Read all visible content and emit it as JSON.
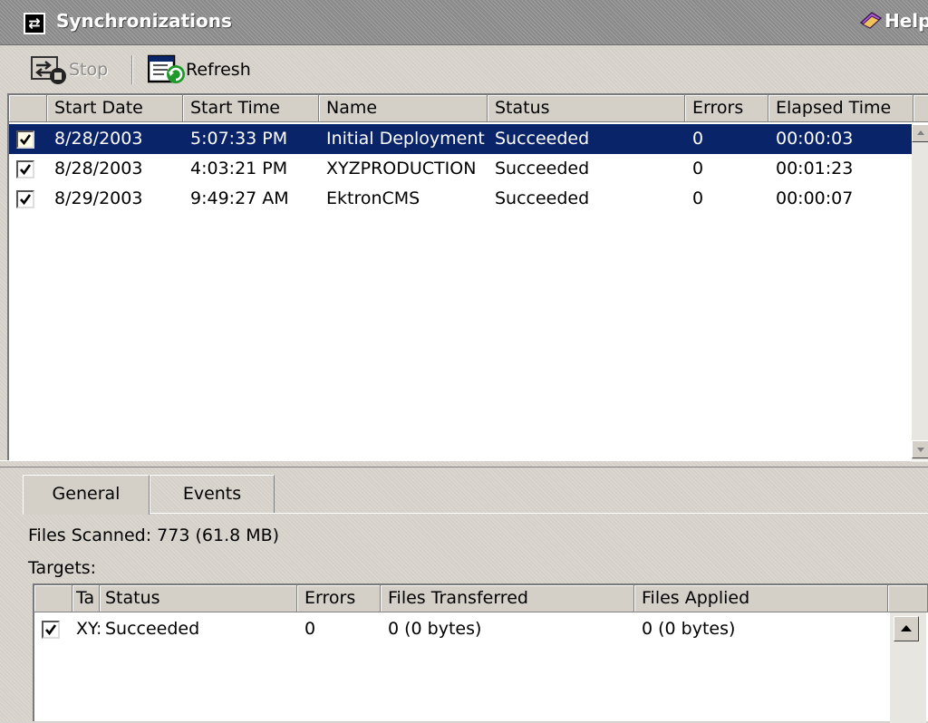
{
  "titlebar": {
    "title": "Synchronizations",
    "help": "Help"
  },
  "toolbar": {
    "stop": "Stop",
    "refresh": "Refresh"
  },
  "list": {
    "columns": [
      "Start Date",
      "Start Time",
      "Name",
      "Status",
      "Errors",
      "Elapsed Time"
    ],
    "rows": [
      {
        "checked": true,
        "start_date": "8/28/2003",
        "start_time": "5:07:33 PM",
        "name": "Initial Deployment",
        "status": "Succeeded",
        "errors": "0",
        "elapsed": "00:00:03",
        "selected": true
      },
      {
        "checked": true,
        "start_date": "8/28/2003",
        "start_time": "4:03:21 PM",
        "name": "XYZPRODUCTION",
        "status": "Succeeded",
        "errors": "0",
        "elapsed": "00:01:23",
        "selected": false
      },
      {
        "checked": true,
        "start_date": "8/29/2003",
        "start_time": "9:49:27 AM",
        "name": "EktronCMS",
        "status": "Succeeded",
        "errors": "0",
        "elapsed": "00:00:07",
        "selected": false
      }
    ]
  },
  "details": {
    "tabs": [
      "General",
      "Events"
    ],
    "active_tab": "General",
    "files_scanned_label": "Files Scanned:",
    "files_scanned_value": "773 (61.8 MB)",
    "targets_label": "Targets:",
    "targets": {
      "columns": [
        "Ta",
        "Status",
        "Errors",
        "Files Transferred",
        "Files Applied"
      ],
      "rows": [
        {
          "checked": true,
          "target": "XY:",
          "status": "Succeeded",
          "errors": "0",
          "files_transferred": "0 (0 bytes)",
          "files_applied": "0 (0 bytes)"
        }
      ]
    }
  },
  "colors": {
    "selection": "#0a246a",
    "panel": "#d4d0c8",
    "titlebar": "#8a8a8a"
  }
}
